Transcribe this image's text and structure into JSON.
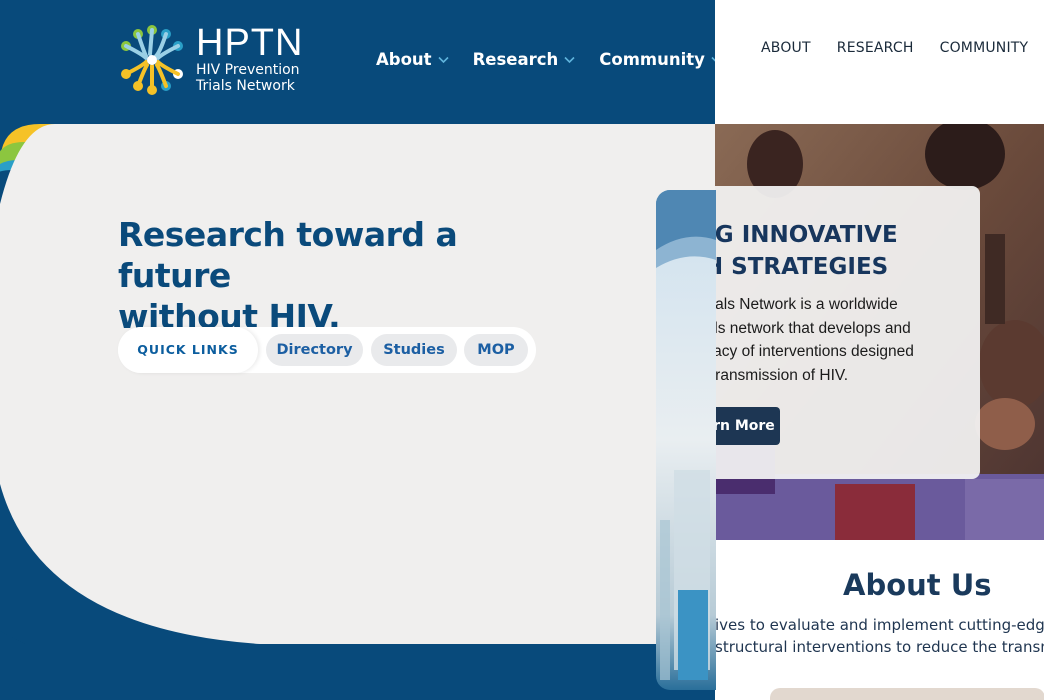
{
  "brand": {
    "name": "HPTN",
    "subtitle_line1": "HIV Prevention",
    "subtitle_line2": "Trials Network",
    "colors": {
      "navy": "#084a7b",
      "yellow": "#f5c227",
      "green": "#8cc63f",
      "teal": "#2a9fc7"
    }
  },
  "main_nav": [
    {
      "label": "About"
    },
    {
      "label": "Research"
    },
    {
      "label": "Community"
    }
  ],
  "hero": {
    "headline_line1": "Research toward a future",
    "headline_line2": "without HIV."
  },
  "quick_links": {
    "label": "QUICK LINKS",
    "items": [
      {
        "label": "Directory"
      },
      {
        "label": "Studies"
      },
      {
        "label": "MOP"
      }
    ]
  },
  "secondary_nav": [
    {
      "label": "ABOUT"
    },
    {
      "label": "RESEARCH"
    },
    {
      "label": "COMMUNITY"
    }
  ],
  "feature": {
    "title_line1": "ING INNOVATIVE",
    "title_line2": "CH STRATEGIES",
    "body": [
      "n Trials Network is a worldwide",
      "l trials network that develops and",
      "efficacy of interventions designed",
      "the transmission of HIV."
    ],
    "button": "Learn More"
  },
  "about": {
    "title": "About Us",
    "body_line1": "ives to evaluate and implement cutting-edge bio",
    "body_line2": "structural interventions to reduce the transmis"
  }
}
